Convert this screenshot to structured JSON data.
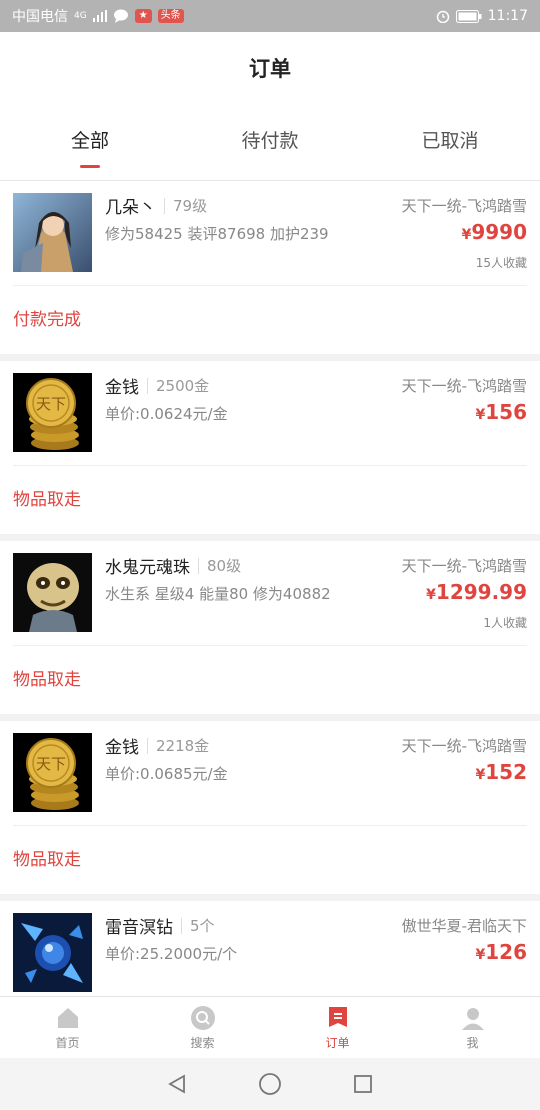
{
  "status_bar": {
    "carrier": "中国电信",
    "network": "4G",
    "badge": "头条",
    "time": "11:17"
  },
  "header": {
    "title": "订单"
  },
  "tabs": [
    {
      "label": "全部",
      "active": true
    },
    {
      "label": "待付款",
      "active": false
    },
    {
      "label": "已取消",
      "active": false
    }
  ],
  "orders": [
    {
      "name": "几朵丶",
      "level": "79级",
      "desc": "修为58425 装评87698 加护239",
      "server": "天下一统-飞鸿踏雪",
      "currency": "¥",
      "price": "9990",
      "favorites": "15人收藏",
      "status": "付款完成",
      "thumb_icon": "warrior-portrait-icon"
    },
    {
      "name": "金钱",
      "level": "2500金",
      "desc": "单价:0.0624元/金",
      "server": "天下一统-飞鸿踏雪",
      "currency": "¥",
      "price": "156",
      "favorites": "",
      "status": "物品取走",
      "thumb_icon": "gold-coins-icon"
    },
    {
      "name": "水鬼元魂珠",
      "level": "80级",
      "desc": "水生系 星级4 能量80 修为40882",
      "server": "天下一统-飞鸿踏雪",
      "currency": "¥",
      "price": "1299.99",
      "favorites": "1人收藏",
      "status": "物品取走",
      "thumb_icon": "water-ghost-icon"
    },
    {
      "name": "金钱",
      "level": "2218金",
      "desc": "单价:0.0685元/金",
      "server": "天下一统-飞鸿踏雪",
      "currency": "¥",
      "price": "152",
      "favorites": "",
      "status": "物品取走",
      "thumb_icon": "gold-coins-icon"
    },
    {
      "name": "雷音溟钻",
      "level": "5个",
      "desc": "单价:25.2000元/个",
      "server": "傲世华夏-君临天下",
      "currency": "¥",
      "price": "126",
      "favorites": "",
      "status": "",
      "thumb_icon": "blue-gem-icon"
    }
  ],
  "bottom_nav": [
    {
      "label": "首页",
      "icon": "home-icon",
      "active": false
    },
    {
      "label": "搜索",
      "icon": "search-icon",
      "active": false
    },
    {
      "label": "订单",
      "icon": "order-icon",
      "active": true
    },
    {
      "label": "我",
      "icon": "user-icon",
      "active": false
    }
  ],
  "colors": {
    "accent": "#e0443e",
    "status_bar": "#b3b3b3"
  }
}
